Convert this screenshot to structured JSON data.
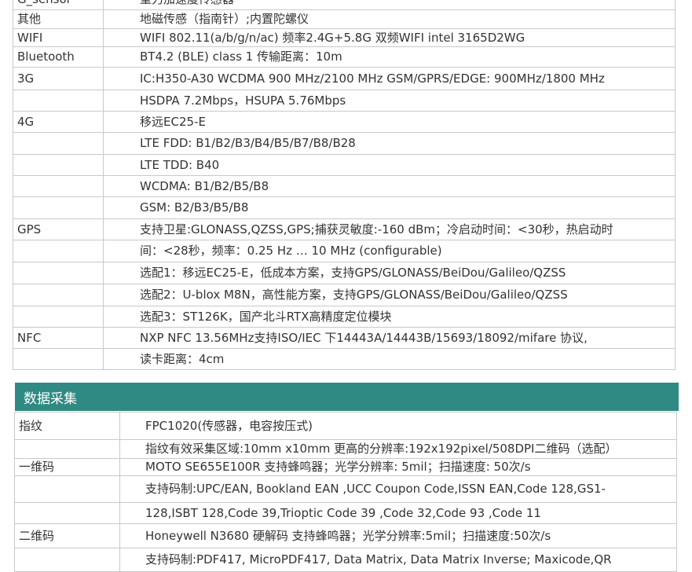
{
  "specs": {
    "rows": [
      {
        "label": "G_sensor",
        "value": "重力加速度传感器",
        "h": 26
      },
      {
        "label": "其他",
        "value": "地磁传感（指南针）;内置陀螺仪",
        "h": 24
      },
      {
        "label": "WIFI",
        "value": "WIFI 802.11(a/b/g/n/ac)  频率2.4G+5.8G 双频WIFI intel 3165D2WG",
        "h": 23
      },
      {
        "label": "Bluetooth",
        "value": "BT4.2 (BLE) class 1 传输距离：10m",
        "h": 26
      },
      {
        "label": "3G",
        "value": "IC:H350-A30  WCDMA 900 MHz/2100 MHz GSM/GPRS/EDGE: 900MHz/1800 MHz",
        "h": 29
      },
      {
        "label": "",
        "value": "HSDPA 7.2Mbps，HSUPA 5.76Mbps",
        "h": 27
      },
      {
        "label": "4G",
        "value": "移远EC25-E",
        "h": 27
      },
      {
        "label": "",
        "value": "LTE FDD: B1/B2/B3/B4/B5/B7/B8/B28",
        "h": 28
      },
      {
        "label": "",
        "value": "LTE TDD: B40",
        "h": 27
      },
      {
        "label": "",
        "value": "WCDMA: B1/B2/B5/B8",
        "h": 27
      },
      {
        "label": "",
        "value": "GSM: B2/B3/B5/B8",
        "h": 28
      },
      {
        "label": "GPS",
        "value": "支持卫星:GLONASS,QZSS,GPS;捕获灵敏度:-160 dBm；冷启动时间：<30秒，热启动时",
        "h": 27
      },
      {
        "label": "",
        "value": "间：<28秒，频率：0.25 Hz … 10 MHz (configurable)",
        "h": 28
      },
      {
        "label": "",
        "value": "选配1：移远EC25-E，低成本方案，支持GPS/GLONASS/BeiDou/Galileo/QZSS",
        "h": 28
      },
      {
        "label": "",
        "value": "选配2：U-blox M8N，高性能方案，支持GPS/GLONASS/BeiDou/Galileo/QZSS",
        "h": 28
      },
      {
        "label": "",
        "value": "选配3：ST126K，国产北斗RTX高精度定位模块",
        "h": 27
      },
      {
        "label": "NFC",
        "value": "NXP NFC 13.56MHz支持ISO/IEC 下14443A/14443B/15693/18092/mifare 协议,",
        "h": 27
      },
      {
        "label": "",
        "value": "读卡距离：4cm",
        "h": 27
      }
    ]
  },
  "data_section": {
    "title": "数据采集",
    "rows": [
      {
        "label": "指纹",
        "value": "FPC1020(传感器，电容按压式)",
        "h": 35
      },
      {
        "label": "",
        "value": "指纹有效采集区域:10mm x10mm 更高的分辨率:192x192pixel/508DPI二维码（选配）",
        "h": 24
      },
      {
        "label": "一维码",
        "value": "MOTO  SE655E100R  支持蜂鸣器；光学分辨率: 5mil；扫描速度: 50次/s",
        "h": 22
      },
      {
        "label": "",
        "value": "支持码制:UPC/EAN, Bookland EAN ,UCC Coupon Code,ISSN EAN,Code 128,GS1-",
        "h": 34
      },
      {
        "label": "",
        "value": "128,ISBT 128,Code 39,Trioptic Code 39 ,Code 32,Code 93  ,Code 11",
        "h": 27
      },
      {
        "label": "二维码",
        "value": "Honeywell N3680   硬解码 支持蜂鸣器；光学分辨率:5mil；扫描速度:50次/s",
        "h": 31
      },
      {
        "label": "",
        "value": "支持码制:PDF417, MicroPDF417, Data Matrix, Data Matrix Inverse;  Maxicode,QR",
        "h": 30
      }
    ]
  }
}
